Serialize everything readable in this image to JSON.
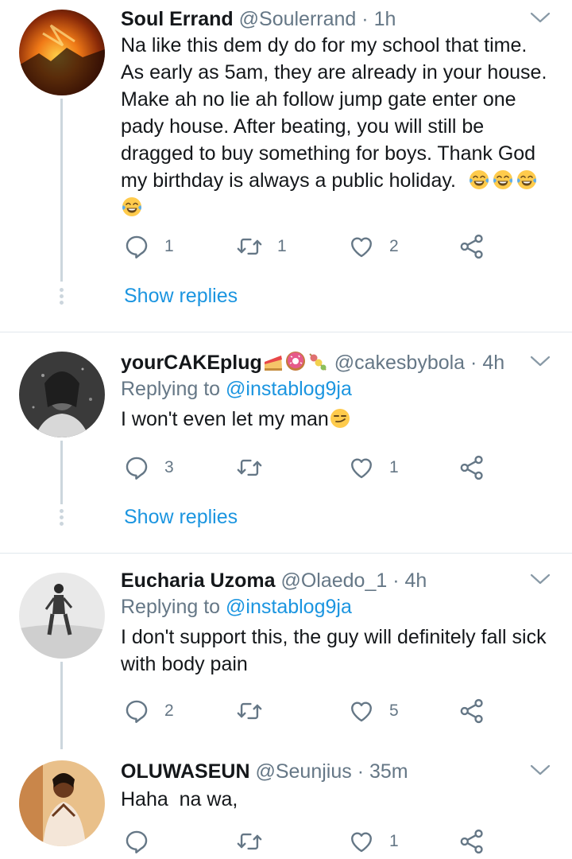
{
  "tweets": [
    {
      "name": "Soul Errand",
      "handle": "@Soulerrand",
      "dot": "·",
      "time": "1h",
      "text_lines": [
        "Na like this dem dy do for my school that time.",
        "As early as 5am, they are already in your house.",
        "Make ah no lie ah follow jump gate enter one",
        "pady house. After beating, you will still be",
        "dragged to buy something for boys. Thank God",
        "my birthday is always a public holiday."
      ],
      "emoji": "face-with-tears-of-joy",
      "reply_count": "1",
      "retweet_count": "1",
      "like_count": "2",
      "show_replies": "Show replies"
    },
    {
      "name": "yourCAKEplug",
      "name_emojis": [
        "cake-icon",
        "doughnut-icon",
        "dango-icon"
      ],
      "handle": "@cakesbybola",
      "dot": "·",
      "time": "4h",
      "replying_prefix": "Replying to",
      "replying_to": "@instablog9ja",
      "text": "I won't even let my man",
      "emoji": "smirking-face",
      "reply_count": "3",
      "retweet_count": "",
      "like_count": "1",
      "show_replies": "Show replies"
    },
    {
      "name": "Eucharia Uzoma",
      "handle": "@Olaedo_1",
      "dot": "·",
      "time": "4h",
      "replying_prefix": "Replying to",
      "replying_to": "@instablog9ja",
      "text_lines": [
        "I don't support this, the guy will definitely fall sick",
        "with body pain"
      ],
      "reply_count": "2",
      "retweet_count": "",
      "like_count": "5"
    },
    {
      "name": "OLUWASEUN",
      "handle": "@Seunjius",
      "dot": "·",
      "time": "35m",
      "text": "Haha  na wa,",
      "reply_count": "",
      "retweet_count": "",
      "like_count": "1"
    }
  ],
  "colors": {
    "text": "#14171a",
    "secondary": "#657786",
    "link": "#1b95e0",
    "divider": "#e1e8ed",
    "thread_line": "#ccd6dd"
  }
}
